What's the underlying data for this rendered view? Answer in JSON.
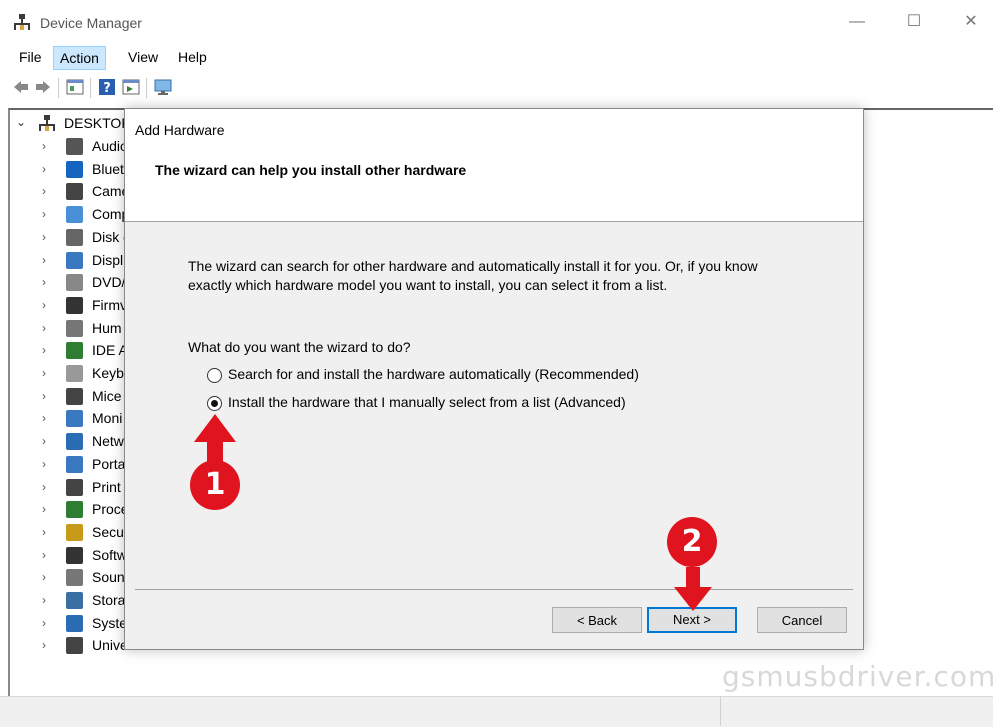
{
  "window": {
    "title": "Device Manager",
    "controls": {
      "minimize": "—",
      "maximize": "☐",
      "close": "✕"
    }
  },
  "menu": {
    "file": "File",
    "action": "Action",
    "view": "View",
    "help": "Help"
  },
  "toolbar": {
    "icons": [
      "back-arrow-icon",
      "forward-arrow-icon",
      "properties-icon",
      "help-icon",
      "update-driver-icon",
      "monitor-icon"
    ]
  },
  "tree": {
    "root": "DESKTOP",
    "items": [
      {
        "label": "Audio",
        "icon": "speaker-icon"
      },
      {
        "label": "Bluet",
        "icon": "bluetooth-icon"
      },
      {
        "label": "Came",
        "icon": "camera-icon"
      },
      {
        "label": "Comp",
        "icon": "computer-icon"
      },
      {
        "label": "Disk d",
        "icon": "disk-icon"
      },
      {
        "label": "Displ",
        "icon": "display-icon"
      },
      {
        "label": "DVD/",
        "icon": "dvd-icon"
      },
      {
        "label": "Firmv",
        "icon": "firmware-icon"
      },
      {
        "label": "Hum",
        "icon": "hid-icon"
      },
      {
        "label": "IDE A",
        "icon": "ide-icon"
      },
      {
        "label": "Keyb",
        "icon": "keyboard-icon"
      },
      {
        "label": "Mice",
        "icon": "mouse-icon"
      },
      {
        "label": "Moni",
        "icon": "monitor-icon"
      },
      {
        "label": "Netw",
        "icon": "network-icon"
      },
      {
        "label": "Porta",
        "icon": "portable-icon"
      },
      {
        "label": "Print",
        "icon": "printer-icon"
      },
      {
        "label": "Proce",
        "icon": "processor-icon"
      },
      {
        "label": "Secur",
        "icon": "security-icon"
      },
      {
        "label": "Softw",
        "icon": "software-icon"
      },
      {
        "label": "Soun",
        "icon": "sound-icon"
      },
      {
        "label": "Stora",
        "icon": "storage-icon"
      },
      {
        "label": "Syster",
        "icon": "system-icon"
      },
      {
        "label": "Universal Serial Bus controllers",
        "icon": "usb-icon"
      }
    ]
  },
  "dialog": {
    "title": "Add Hardware",
    "heading": "The wizard can help you install other hardware",
    "description": "The wizard can search for other hardware and automatically install it for you. Or, if you know exactly which hardware model you want to install, you can select it from a list.",
    "question": "What do you want the wizard to do?",
    "options": [
      {
        "label": "Search for and install the hardware automatically (Recommended)",
        "selected": false
      },
      {
        "label": "Install the hardware that I manually select from a list (Advanced)",
        "selected": true
      }
    ],
    "buttons": {
      "back": "< Back",
      "next": "Next >",
      "cancel": "Cancel"
    }
  },
  "annotations": {
    "step1": "1",
    "step2": "2",
    "color": "#e0141e"
  },
  "watermark": "gsmusbdriver.com"
}
